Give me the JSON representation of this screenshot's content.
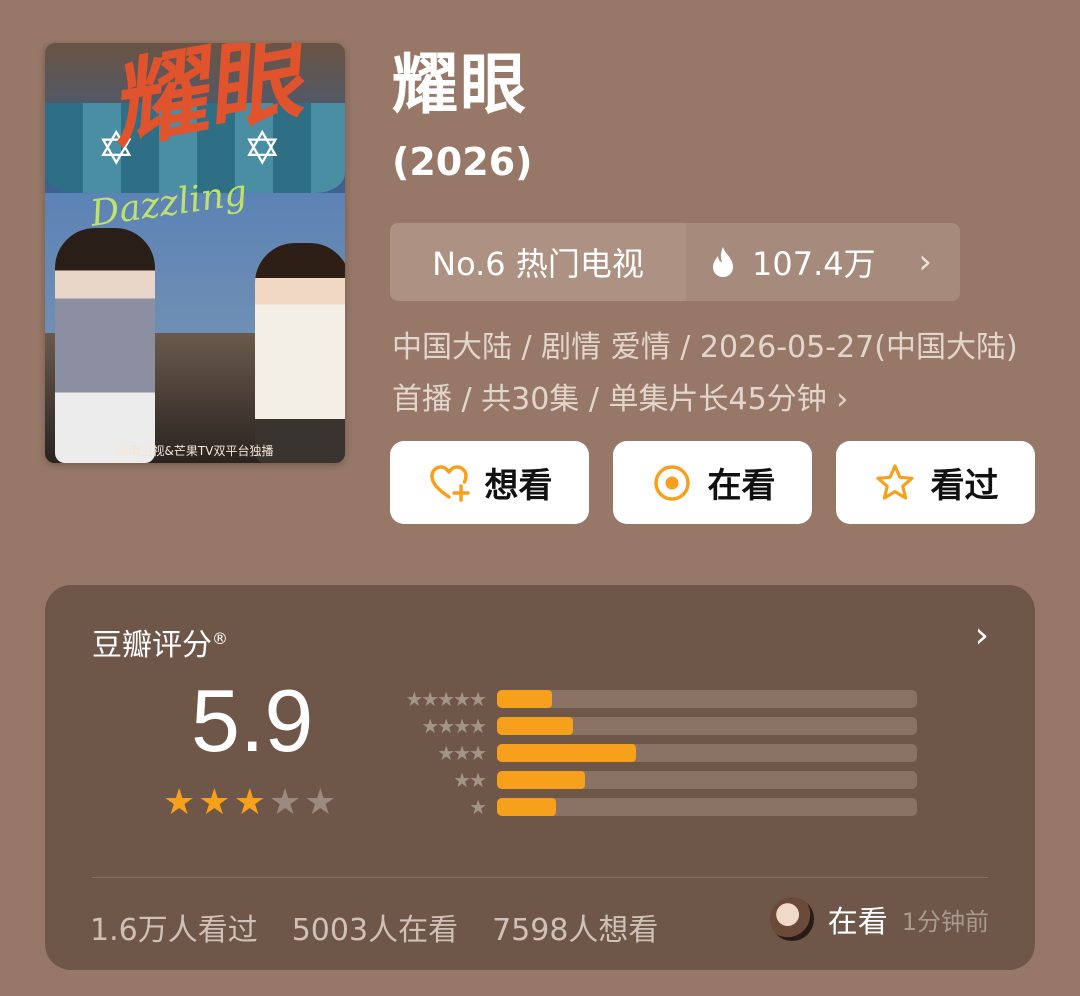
{
  "poster": {
    "title_art": "耀眼",
    "subtitle_art": "Dazzling",
    "footer": "湖南卫视&芒果TV双平台独播"
  },
  "show": {
    "title": "耀眼",
    "year": "(2026)"
  },
  "ranking": {
    "rank_label": "No.6 热门电视",
    "heat_value": "107.4万",
    "chevron": "›"
  },
  "meta": {
    "text": "中国大陆 / 剧情 爱情 / 2026-05-27(中国大陆)首播 / 共30集 / 单集片长45分钟 ›"
  },
  "actions": [
    {
      "label": "想看",
      "icon": "heart-plus-icon"
    },
    {
      "label": "在看",
      "icon": "target-circle-icon"
    },
    {
      "label": "看过",
      "icon": "star-outline-icon"
    }
  ],
  "rating": {
    "title": "豆瓣评分",
    "registered": "®",
    "chevron": "›",
    "score": "5.9",
    "stars_filled": 3,
    "stars_total": 5,
    "distribution": [
      {
        "stars": 5,
        "fraction": 0.13
      },
      {
        "stars": 4,
        "fraction": 0.18
      },
      {
        "stars": 3,
        "fraction": 0.33
      },
      {
        "stars": 2,
        "fraction": 0.21
      },
      {
        "stars": 1,
        "fraction": 0.14
      }
    ]
  },
  "stats": {
    "watched": "1.6万人看过",
    "watching": "5003人在看",
    "want": "7598人想看"
  },
  "recent": {
    "status": "在看",
    "time": "1分钟前"
  },
  "colors": {
    "background": "#977868",
    "card": "#6e5649",
    "accent": "#f7a01b"
  }
}
